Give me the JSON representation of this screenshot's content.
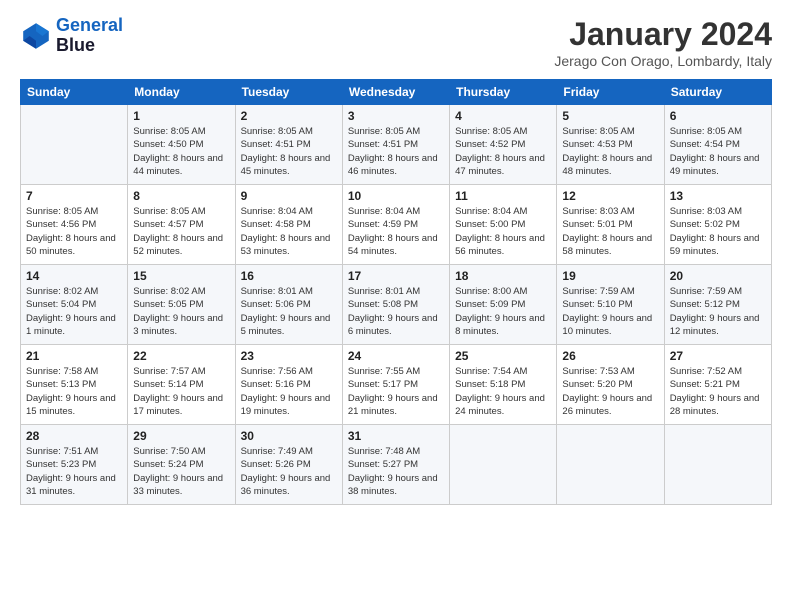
{
  "logo": {
    "line1": "General",
    "line2": "Blue"
  },
  "title": "January 2024",
  "location": "Jerago Con Orago, Lombardy, Italy",
  "weekdays": [
    "Sunday",
    "Monday",
    "Tuesday",
    "Wednesday",
    "Thursday",
    "Friday",
    "Saturday"
  ],
  "weeks": [
    [
      {
        "day": "",
        "sunrise": "",
        "sunset": "",
        "daylight": ""
      },
      {
        "day": "1",
        "sunrise": "Sunrise: 8:05 AM",
        "sunset": "Sunset: 4:50 PM",
        "daylight": "Daylight: 8 hours and 44 minutes."
      },
      {
        "day": "2",
        "sunrise": "Sunrise: 8:05 AM",
        "sunset": "Sunset: 4:51 PM",
        "daylight": "Daylight: 8 hours and 45 minutes."
      },
      {
        "day": "3",
        "sunrise": "Sunrise: 8:05 AM",
        "sunset": "Sunset: 4:51 PM",
        "daylight": "Daylight: 8 hours and 46 minutes."
      },
      {
        "day": "4",
        "sunrise": "Sunrise: 8:05 AM",
        "sunset": "Sunset: 4:52 PM",
        "daylight": "Daylight: 8 hours and 47 minutes."
      },
      {
        "day": "5",
        "sunrise": "Sunrise: 8:05 AM",
        "sunset": "Sunset: 4:53 PM",
        "daylight": "Daylight: 8 hours and 48 minutes."
      },
      {
        "day": "6",
        "sunrise": "Sunrise: 8:05 AM",
        "sunset": "Sunset: 4:54 PM",
        "daylight": "Daylight: 8 hours and 49 minutes."
      }
    ],
    [
      {
        "day": "7",
        "sunrise": "Sunrise: 8:05 AM",
        "sunset": "Sunset: 4:56 PM",
        "daylight": "Daylight: 8 hours and 50 minutes."
      },
      {
        "day": "8",
        "sunrise": "Sunrise: 8:05 AM",
        "sunset": "Sunset: 4:57 PM",
        "daylight": "Daylight: 8 hours and 52 minutes."
      },
      {
        "day": "9",
        "sunrise": "Sunrise: 8:04 AM",
        "sunset": "Sunset: 4:58 PM",
        "daylight": "Daylight: 8 hours and 53 minutes."
      },
      {
        "day": "10",
        "sunrise": "Sunrise: 8:04 AM",
        "sunset": "Sunset: 4:59 PM",
        "daylight": "Daylight: 8 hours and 54 minutes."
      },
      {
        "day": "11",
        "sunrise": "Sunrise: 8:04 AM",
        "sunset": "Sunset: 5:00 PM",
        "daylight": "Daylight: 8 hours and 56 minutes."
      },
      {
        "day": "12",
        "sunrise": "Sunrise: 8:03 AM",
        "sunset": "Sunset: 5:01 PM",
        "daylight": "Daylight: 8 hours and 58 minutes."
      },
      {
        "day": "13",
        "sunrise": "Sunrise: 8:03 AM",
        "sunset": "Sunset: 5:02 PM",
        "daylight": "Daylight: 8 hours and 59 minutes."
      }
    ],
    [
      {
        "day": "14",
        "sunrise": "Sunrise: 8:02 AM",
        "sunset": "Sunset: 5:04 PM",
        "daylight": "Daylight: 9 hours and 1 minute."
      },
      {
        "day": "15",
        "sunrise": "Sunrise: 8:02 AM",
        "sunset": "Sunset: 5:05 PM",
        "daylight": "Daylight: 9 hours and 3 minutes."
      },
      {
        "day": "16",
        "sunrise": "Sunrise: 8:01 AM",
        "sunset": "Sunset: 5:06 PM",
        "daylight": "Daylight: 9 hours and 5 minutes."
      },
      {
        "day": "17",
        "sunrise": "Sunrise: 8:01 AM",
        "sunset": "Sunset: 5:08 PM",
        "daylight": "Daylight: 9 hours and 6 minutes."
      },
      {
        "day": "18",
        "sunrise": "Sunrise: 8:00 AM",
        "sunset": "Sunset: 5:09 PM",
        "daylight": "Daylight: 9 hours and 8 minutes."
      },
      {
        "day": "19",
        "sunrise": "Sunrise: 7:59 AM",
        "sunset": "Sunset: 5:10 PM",
        "daylight": "Daylight: 9 hours and 10 minutes."
      },
      {
        "day": "20",
        "sunrise": "Sunrise: 7:59 AM",
        "sunset": "Sunset: 5:12 PM",
        "daylight": "Daylight: 9 hours and 12 minutes."
      }
    ],
    [
      {
        "day": "21",
        "sunrise": "Sunrise: 7:58 AM",
        "sunset": "Sunset: 5:13 PM",
        "daylight": "Daylight: 9 hours and 15 minutes."
      },
      {
        "day": "22",
        "sunrise": "Sunrise: 7:57 AM",
        "sunset": "Sunset: 5:14 PM",
        "daylight": "Daylight: 9 hours and 17 minutes."
      },
      {
        "day": "23",
        "sunrise": "Sunrise: 7:56 AM",
        "sunset": "Sunset: 5:16 PM",
        "daylight": "Daylight: 9 hours and 19 minutes."
      },
      {
        "day": "24",
        "sunrise": "Sunrise: 7:55 AM",
        "sunset": "Sunset: 5:17 PM",
        "daylight": "Daylight: 9 hours and 21 minutes."
      },
      {
        "day": "25",
        "sunrise": "Sunrise: 7:54 AM",
        "sunset": "Sunset: 5:18 PM",
        "daylight": "Daylight: 9 hours and 24 minutes."
      },
      {
        "day": "26",
        "sunrise": "Sunrise: 7:53 AM",
        "sunset": "Sunset: 5:20 PM",
        "daylight": "Daylight: 9 hours and 26 minutes."
      },
      {
        "day": "27",
        "sunrise": "Sunrise: 7:52 AM",
        "sunset": "Sunset: 5:21 PM",
        "daylight": "Daylight: 9 hours and 28 minutes."
      }
    ],
    [
      {
        "day": "28",
        "sunrise": "Sunrise: 7:51 AM",
        "sunset": "Sunset: 5:23 PM",
        "daylight": "Daylight: 9 hours and 31 minutes."
      },
      {
        "day": "29",
        "sunrise": "Sunrise: 7:50 AM",
        "sunset": "Sunset: 5:24 PM",
        "daylight": "Daylight: 9 hours and 33 minutes."
      },
      {
        "day": "30",
        "sunrise": "Sunrise: 7:49 AM",
        "sunset": "Sunset: 5:26 PM",
        "daylight": "Daylight: 9 hours and 36 minutes."
      },
      {
        "day": "31",
        "sunrise": "Sunrise: 7:48 AM",
        "sunset": "Sunset: 5:27 PM",
        "daylight": "Daylight: 9 hours and 38 minutes."
      },
      {
        "day": "",
        "sunrise": "",
        "sunset": "",
        "daylight": ""
      },
      {
        "day": "",
        "sunrise": "",
        "sunset": "",
        "daylight": ""
      },
      {
        "day": "",
        "sunrise": "",
        "sunset": "",
        "daylight": ""
      }
    ]
  ]
}
